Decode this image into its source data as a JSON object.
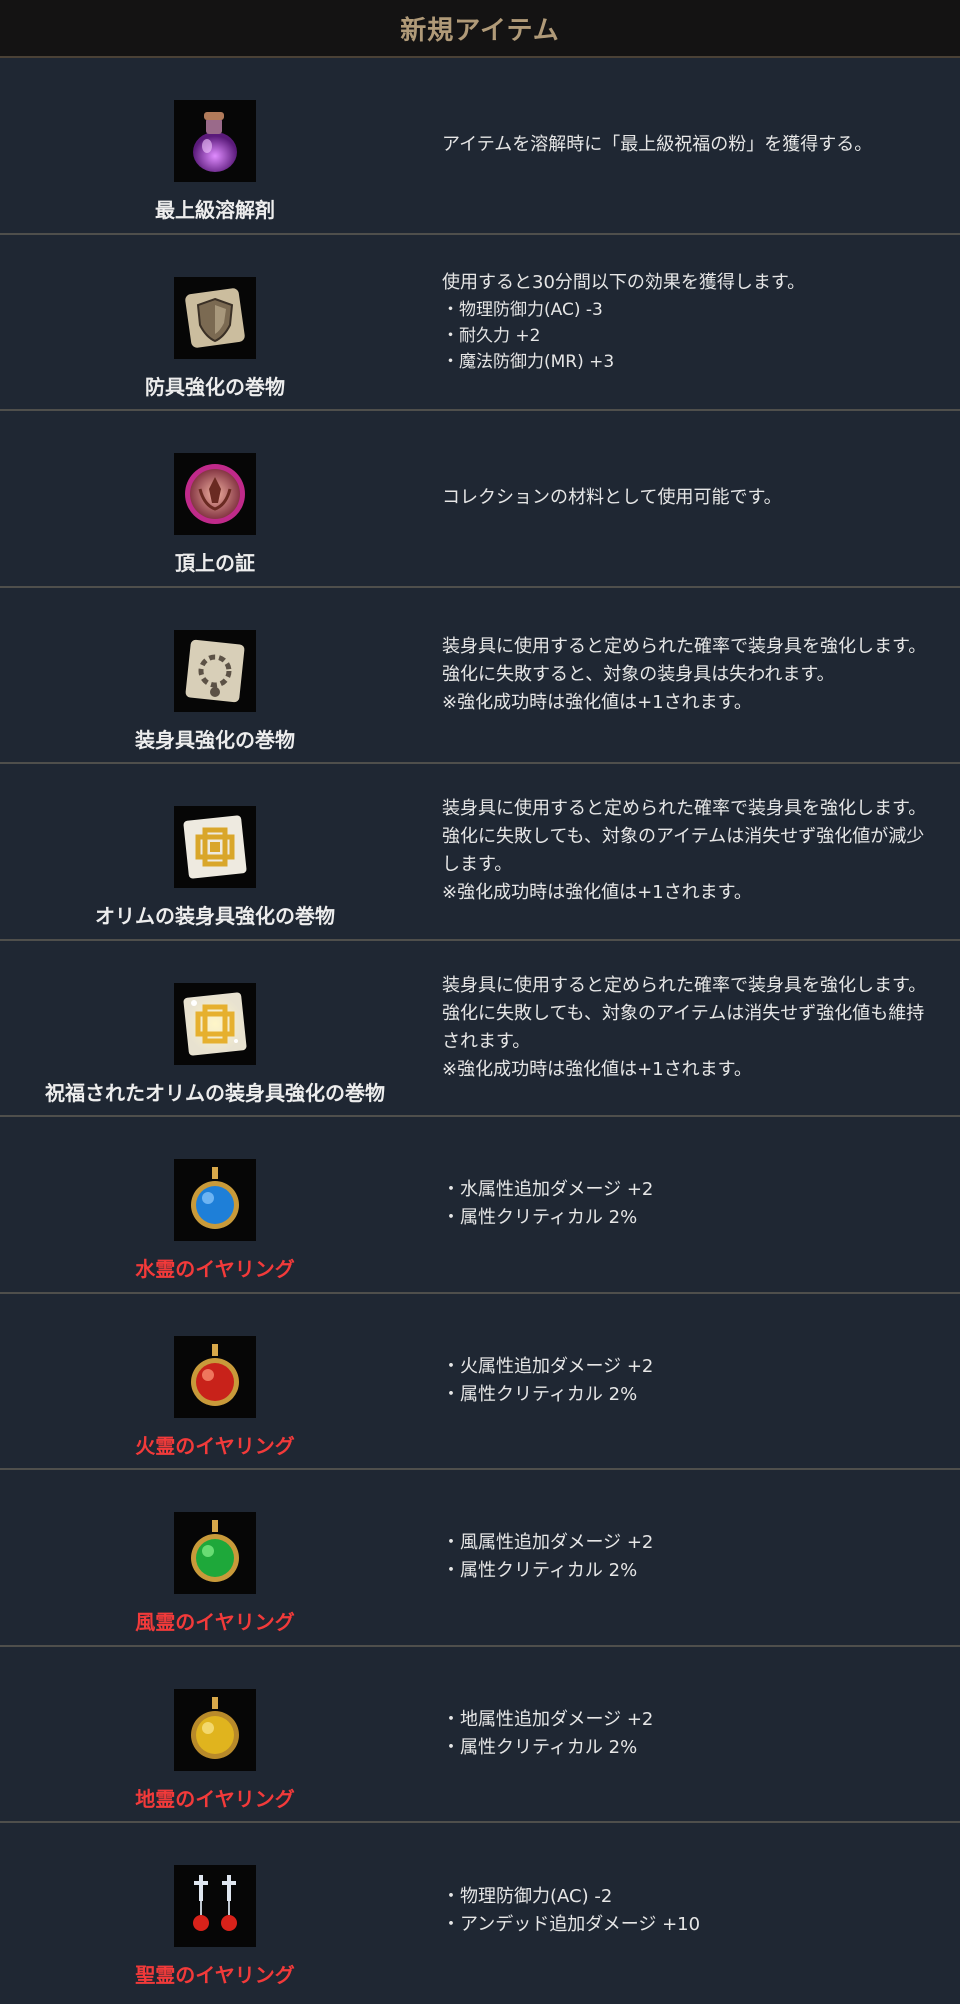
{
  "header": {
    "title": "新規アイテム"
  },
  "items": [
    {
      "name": "最上級溶解剤",
      "icon": "purple-potion-icon",
      "desc": [
        "アイテムを溶解時に「最上級祝福の粉」を獲得する。"
      ]
    },
    {
      "name": "防具強化の巻物",
      "icon": "armor-scroll-icon",
      "desc": [
        "使用すると30分間以下の効果を獲得します。",
        "・物理防御力(AC) -3",
        "・耐久力 +2",
        "・魔法防御力(MR) +3"
      ]
    },
    {
      "name": "頂上の証",
      "icon": "summit-medal-icon",
      "desc": [
        "コレクションの材料として使用可能です。"
      ]
    },
    {
      "name": "装身具強化の巻物",
      "icon": "accessory-scroll-icon",
      "desc": [
        "装身具に使用すると定められた確率で装身具を強化します。",
        "強化に失敗すると、対象の装身具は失われます。",
        "※強化成功時は強化値は+1されます。"
      ]
    },
    {
      "name": "オリムの装身具強化の巻物",
      "icon": "orim-scroll-icon",
      "desc": [
        "装身具に使用すると定められた確率で装身具を強化します。",
        "強化に失敗しても、対象のアイテムは消失せず強化値が減少",
        "します。",
        "※強化成功時は強化値は+1されます。"
      ]
    },
    {
      "name": "祝福されたオリムの装身具強化の巻物",
      "icon": "blessed-orim-scroll-icon",
      "desc": [
        "装身具に使用すると定められた確率で装身具を強化します。",
        "強化に失敗しても、対象のアイテムは消失せず強化値も維持",
        "されます。",
        "※強化成功時は強化値は+1されます。"
      ]
    },
    {
      "name": "水霊のイヤリング",
      "icon": "water-earring-icon",
      "red": true,
      "desc": [
        "・水属性追加ダメージ +2",
        "・属性クリティカル 2%"
      ]
    },
    {
      "name": "火霊のイヤリング",
      "icon": "fire-earring-icon",
      "red": true,
      "desc": [
        "・火属性追加ダメージ +2",
        "・属性クリティカル 2%"
      ]
    },
    {
      "name": "風霊のイヤリング",
      "icon": "wind-earring-icon",
      "red": true,
      "desc": [
        "・風属性追加ダメージ +2",
        "・属性クリティカル 2%"
      ]
    },
    {
      "name": "地霊のイヤリング",
      "icon": "earth-earring-icon",
      "red": true,
      "desc": [
        "・地属性追加ダメージ +2",
        "・属性クリティカル 2%"
      ]
    },
    {
      "name": "聖霊のイヤリング",
      "icon": "holy-earring-icon",
      "red": true,
      "desc": [
        "・物理防御力(AC) -2",
        "・アンデッド追加ダメージ +10"
      ]
    }
  ],
  "colors": {
    "accent_title": "#b09a78",
    "earring_name": "#f23a3a",
    "background": "#1f2733"
  }
}
